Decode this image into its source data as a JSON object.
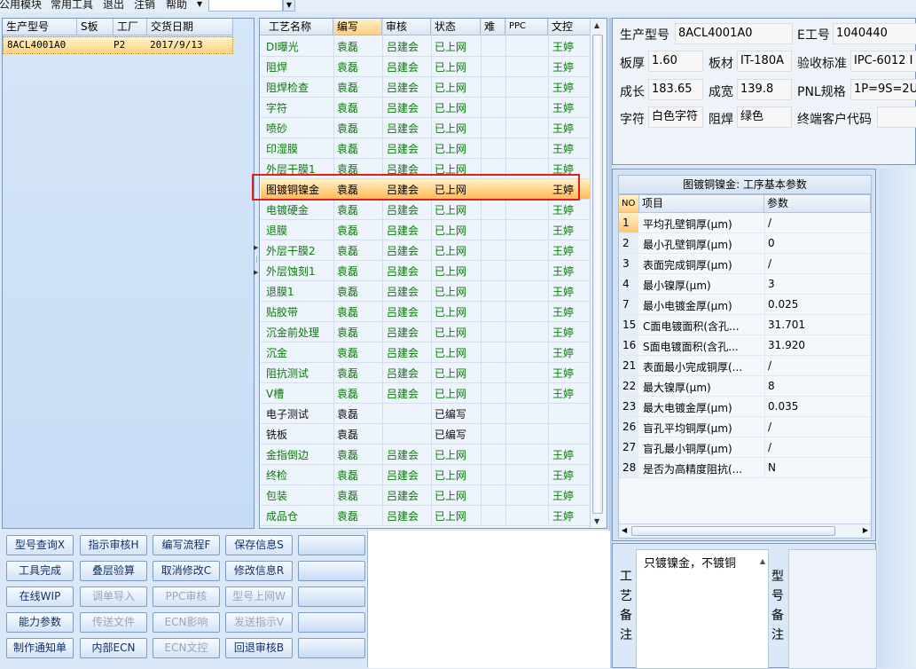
{
  "menu": {
    "items": [
      "公用模块",
      "常用工具",
      "退出",
      "注销",
      "帮助"
    ]
  },
  "left_grid": {
    "headers": [
      "生产型号",
      "S板",
      "工厂",
      "交货日期"
    ],
    "rows": [
      {
        "model": "8ACL4001A0",
        "s": "",
        "factory": "P2",
        "date": "2017/9/13"
      }
    ]
  },
  "process_grid": {
    "headers": [
      "工艺名称",
      "编写",
      "审核",
      "状态",
      "难",
      "PPC",
      "文控"
    ],
    "rows": [
      {
        "name": "DI曝光",
        "writer": "袁磊",
        "reviewer": "吕建会",
        "status": "已上网",
        "hard": "",
        "ppc": "",
        "doc": "王婷"
      },
      {
        "name": "阻焊",
        "writer": "袁磊",
        "reviewer": "吕建会",
        "status": "已上网",
        "hard": "",
        "ppc": "",
        "doc": "王婷"
      },
      {
        "name": "阻焊检查",
        "writer": "袁磊",
        "reviewer": "吕建会",
        "status": "已上网",
        "hard": "",
        "ppc": "",
        "doc": "王婷"
      },
      {
        "name": "字符",
        "writer": "袁磊",
        "reviewer": "吕建会",
        "status": "已上网",
        "hard": "",
        "ppc": "",
        "doc": "王婷"
      },
      {
        "name": "喷砂",
        "writer": "袁磊",
        "reviewer": "吕建会",
        "status": "已上网",
        "hard": "",
        "ppc": "",
        "doc": "王婷"
      },
      {
        "name": "印湿膜",
        "writer": "袁磊",
        "reviewer": "吕建会",
        "status": "已上网",
        "hard": "",
        "ppc": "",
        "doc": "王婷"
      },
      {
        "name": "外层干膜1",
        "writer": "袁磊",
        "reviewer": "吕建会",
        "status": "已上网",
        "hard": "",
        "ppc": "",
        "doc": "王婷"
      },
      {
        "name": "图镀铜镍金",
        "writer": "袁磊",
        "reviewer": "吕建会",
        "status": "已上网",
        "hard": "",
        "ppc": "",
        "doc": "王婷"
      },
      {
        "name": "电镀硬金",
        "writer": "袁磊",
        "reviewer": "吕建会",
        "status": "已上网",
        "hard": "",
        "ppc": "",
        "doc": "王婷"
      },
      {
        "name": "退膜",
        "writer": "袁磊",
        "reviewer": "吕建会",
        "status": "已上网",
        "hard": "",
        "ppc": "",
        "doc": "王婷"
      },
      {
        "name": "外层干膜2",
        "writer": "袁磊",
        "reviewer": "吕建会",
        "status": "已上网",
        "hard": "",
        "ppc": "",
        "doc": "王婷"
      },
      {
        "name": "外层蚀刻1",
        "writer": "袁磊",
        "reviewer": "吕建会",
        "status": "已上网",
        "hard": "",
        "ppc": "",
        "doc": "王婷"
      },
      {
        "name": "退膜1",
        "writer": "袁磊",
        "reviewer": "吕建会",
        "status": "已上网",
        "hard": "",
        "ppc": "",
        "doc": "王婷"
      },
      {
        "name": "贴胶带",
        "writer": "袁磊",
        "reviewer": "吕建会",
        "status": "已上网",
        "hard": "",
        "ppc": "",
        "doc": "王婷"
      },
      {
        "name": "沉金前处理",
        "writer": "袁磊",
        "reviewer": "吕建会",
        "status": "已上网",
        "hard": "",
        "ppc": "",
        "doc": "王婷"
      },
      {
        "name": "沉金",
        "writer": "袁磊",
        "reviewer": "吕建会",
        "status": "已上网",
        "hard": "",
        "ppc": "",
        "doc": "王婷"
      },
      {
        "name": "阻抗测试",
        "writer": "袁磊",
        "reviewer": "吕建会",
        "status": "已上网",
        "hard": "",
        "ppc": "",
        "doc": "王婷"
      },
      {
        "name": "V槽",
        "writer": "袁磊",
        "reviewer": "吕建会",
        "status": "已上网",
        "hard": "",
        "ppc": "",
        "doc": "王婷"
      },
      {
        "name": "电子测试",
        "writer": "袁磊",
        "reviewer": "",
        "status": "已编写",
        "hard": "",
        "ppc": "",
        "doc": ""
      },
      {
        "name": "铣板",
        "writer": "袁磊",
        "reviewer": "",
        "status": "已编写",
        "hard": "",
        "ppc": "",
        "doc": ""
      },
      {
        "name": "金指倒边",
        "writer": "袁磊",
        "reviewer": "吕建会",
        "status": "已上网",
        "hard": "",
        "ppc": "",
        "doc": "王婷"
      },
      {
        "name": "终检",
        "writer": "袁磊",
        "reviewer": "吕建会",
        "status": "已上网",
        "hard": "",
        "ppc": "",
        "doc": "王婷"
      },
      {
        "name": "包装",
        "writer": "袁磊",
        "reviewer": "吕建会",
        "status": "已上网",
        "hard": "",
        "ppc": "",
        "doc": "王婷"
      },
      {
        "name": "成品仓",
        "writer": "袁磊",
        "reviewer": "吕建会",
        "status": "已上网",
        "hard": "",
        "ppc": "",
        "doc": "王婷"
      }
    ]
  },
  "info": {
    "model_label": "生产型号",
    "model_value": "8ACL4001A0",
    "e_label": "E工号",
    "e_value": "1040440",
    "thick_label": "板厚",
    "thick_value": "1.60",
    "mat_label": "板材",
    "mat_value": "IT-180A",
    "std_label": "验收标准",
    "std_value": "IPC-6012 I",
    "len_label": "成长",
    "len_value": "183.65",
    "wid_label": "成宽",
    "wid_value": "139.8",
    "pnl_label": "PNL规格",
    "pnl_value": "1P=9S=2U",
    "char_label": "字符",
    "char_value": "白色字符",
    "mask_label": "阻焊",
    "mask_value": "绿色",
    "cust_label": "终端客户代码",
    "cust_value": ""
  },
  "params": {
    "title": "图镀铜镍金: 工序基本参数",
    "headers": [
      "NO",
      "项目",
      "参数"
    ],
    "rows": [
      {
        "no": "1",
        "item": "平均孔壁铜厚(μm)",
        "value": "/"
      },
      {
        "no": "2",
        "item": "最小孔壁铜厚(μm)",
        "value": "0"
      },
      {
        "no": "3",
        "item": "表面完成铜厚(μm)",
        "value": "/"
      },
      {
        "no": "4",
        "item": "最小镍厚(μm)",
        "value": "3"
      },
      {
        "no": "7",
        "item": "最小电镀金厚(μm)",
        "value": "0.025"
      },
      {
        "no": "15",
        "item": "C面电镀面积(含孔...",
        "value": "31.701"
      },
      {
        "no": "16",
        "item": "S面电镀面积(含孔...",
        "value": "31.920"
      },
      {
        "no": "21",
        "item": "表面最小完成铜厚(...",
        "value": "/"
      },
      {
        "no": "22",
        "item": "最大镍厚(μm)",
        "value": "8"
      },
      {
        "no": "23",
        "item": "最大电镀金厚(μm)",
        "value": "0.035"
      },
      {
        "no": "26",
        "item": "盲孔平均铜厚(μm)",
        "value": "/"
      },
      {
        "no": "27",
        "item": "盲孔最小铜厚(μm)",
        "value": "/"
      },
      {
        "no": "28",
        "item": "是否为高精度阻抗(...",
        "value": "N"
      }
    ]
  },
  "notes": {
    "process_label": "工艺备注",
    "process_text": "只镀镍金，不镀铜",
    "model_label": "型号备注"
  },
  "buttons": [
    [
      "型号查询X",
      "指示审核H",
      "编写流程F",
      "保存信息S",
      ""
    ],
    [
      "工具完成",
      "叠层验算",
      "取消修改C",
      "修改信息R",
      ""
    ],
    [
      "在线WIP",
      "调单导入",
      "PPC审核",
      "型号上网W",
      ""
    ],
    [
      "能力参数",
      "传送文件",
      "ECN影响",
      "发送指示V",
      ""
    ],
    [
      "制作通知单",
      "内部ECN",
      "ECN文控",
      "回退审核B",
      ""
    ]
  ],
  "disabled_buttons": [
    "调单导入",
    "PPC审核",
    "型号上网W",
    "传送文件",
    "ECN影响",
    "发送指示V",
    "ECN文控"
  ]
}
